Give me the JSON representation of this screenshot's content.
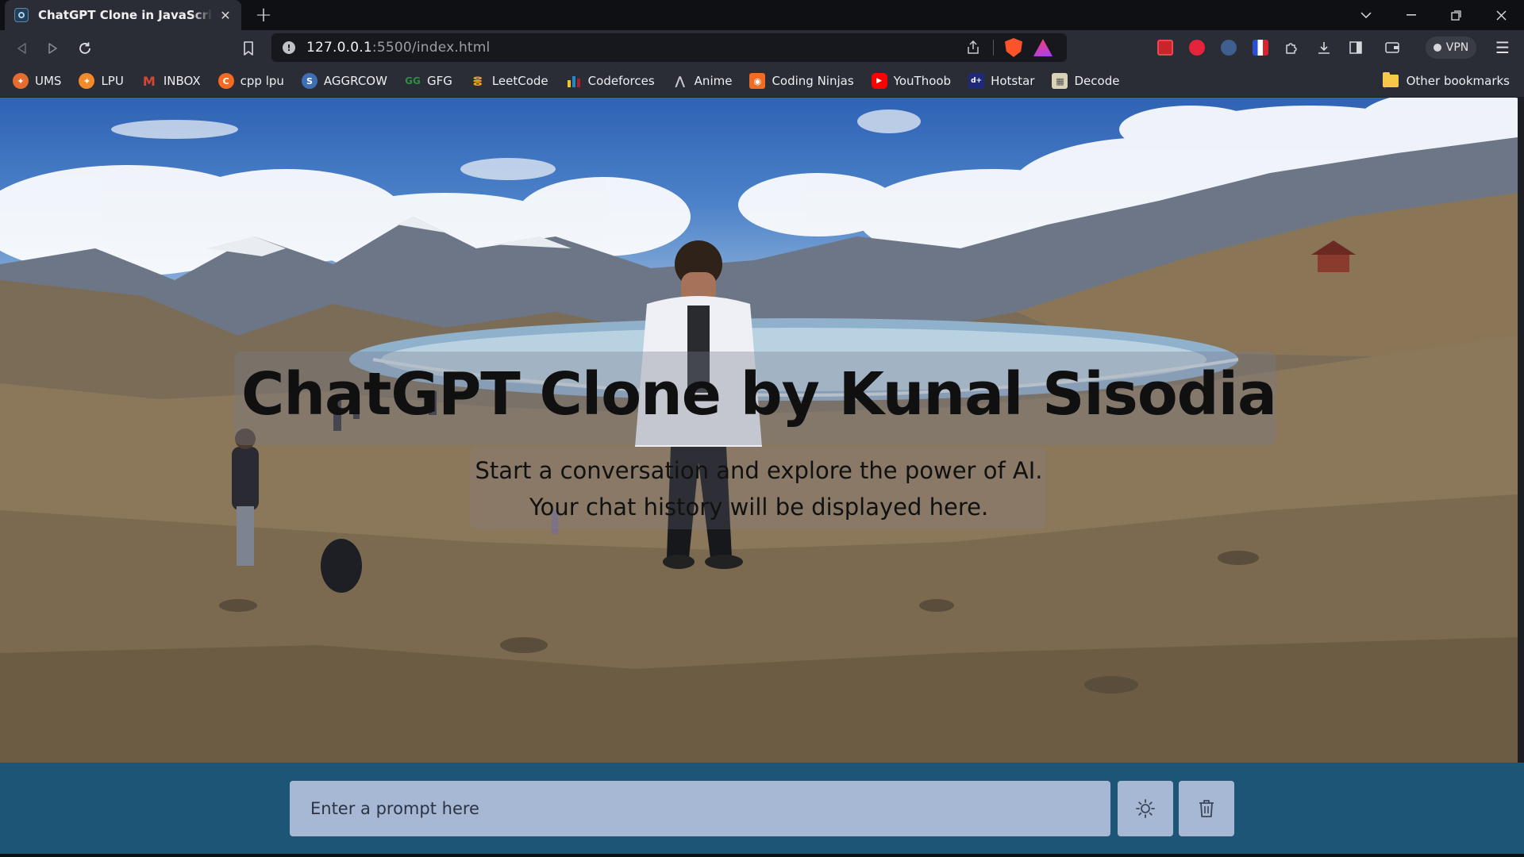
{
  "browser": {
    "tab": {
      "title": "ChatGPT Clone in JavaScript | CodingNepal"
    },
    "url": {
      "host": "127.0.0.1",
      "path": ":5500/index.html"
    },
    "vpn_label": "VPN",
    "bookmarks": [
      {
        "label": "UMS",
        "icon": "ums-icon",
        "color": "#e46c2f"
      },
      {
        "label": "LPU",
        "icon": "lpu-icon",
        "color": "#f08a2a"
      },
      {
        "label": "INBOX",
        "icon": "gmail-icon",
        "color": "#d44638"
      },
      {
        "label": "cpp lpu",
        "icon": "cpp-icon",
        "color": "#f26b21"
      },
      {
        "label": "AGGRCOW",
        "icon": "spoj-icon",
        "color": "#3d6fb5"
      },
      {
        "label": "GFG",
        "icon": "gfg-icon",
        "color": "#2f8d46"
      },
      {
        "label": "LeetCode",
        "icon": "leetcode-icon",
        "color": "#f0a11a"
      },
      {
        "label": "Codeforces",
        "icon": "codeforces-icon",
        "color": "#1f8acb"
      },
      {
        "label": "Anime",
        "icon": "anime-icon",
        "color": "#8d8d95"
      },
      {
        "label": "Coding Ninjas",
        "icon": "codingninjas-icon",
        "color": "#f06b23"
      },
      {
        "label": "YouThoob",
        "icon": "youtube-icon",
        "color": "#ff0000"
      },
      {
        "label": "Hotstar",
        "icon": "hotstar-icon",
        "color": "#1e2a78"
      },
      {
        "label": "Decode",
        "icon": "decode-icon",
        "color": "#d9d2b6"
      }
    ],
    "other_bookmarks": "Other bookmarks"
  },
  "page": {
    "title": "ChatGPT Clone by Kunal Sisodia",
    "subtitle_line1": "Start a conversation and explore the power of AI.",
    "subtitle_line2": "Your chat history will be displayed here.",
    "prompt_placeholder": "Enter a prompt here",
    "theme_button_icon": "sun-icon",
    "delete_button_icon": "trash-icon"
  }
}
